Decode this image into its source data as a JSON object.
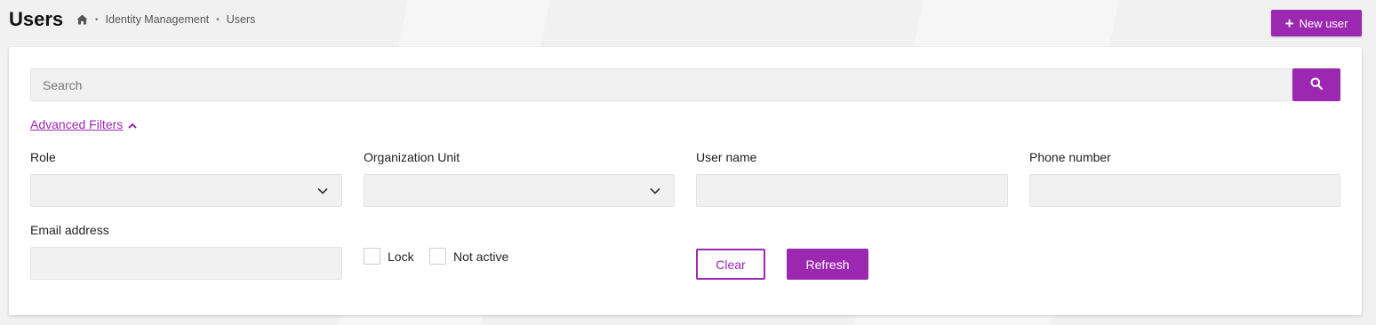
{
  "header": {
    "title": "Users",
    "breadcrumb": [
      "Identity Management",
      "Users"
    ],
    "breadcrumb_separator": "•",
    "new_user_label": "New user"
  },
  "search": {
    "placeholder": "Search",
    "value": ""
  },
  "filters": {
    "toggle_label": "Advanced Filters",
    "role": {
      "label": "Role",
      "value": ""
    },
    "organization_unit": {
      "label": "Organization Unit",
      "value": ""
    },
    "user_name": {
      "label": "User name",
      "value": ""
    },
    "phone_number": {
      "label": "Phone number",
      "value": ""
    },
    "email_address": {
      "label": "Email address",
      "value": ""
    },
    "lock": {
      "label": "Lock",
      "checked": false
    },
    "not_active": {
      "label": "Not active",
      "checked": false
    }
  },
  "actions": {
    "clear_label": "Clear",
    "refresh_label": "Refresh"
  },
  "colors": {
    "accent": "#9c27b0",
    "field_bg": "#f1f1f1",
    "page_bg": "#f1f1f1"
  }
}
